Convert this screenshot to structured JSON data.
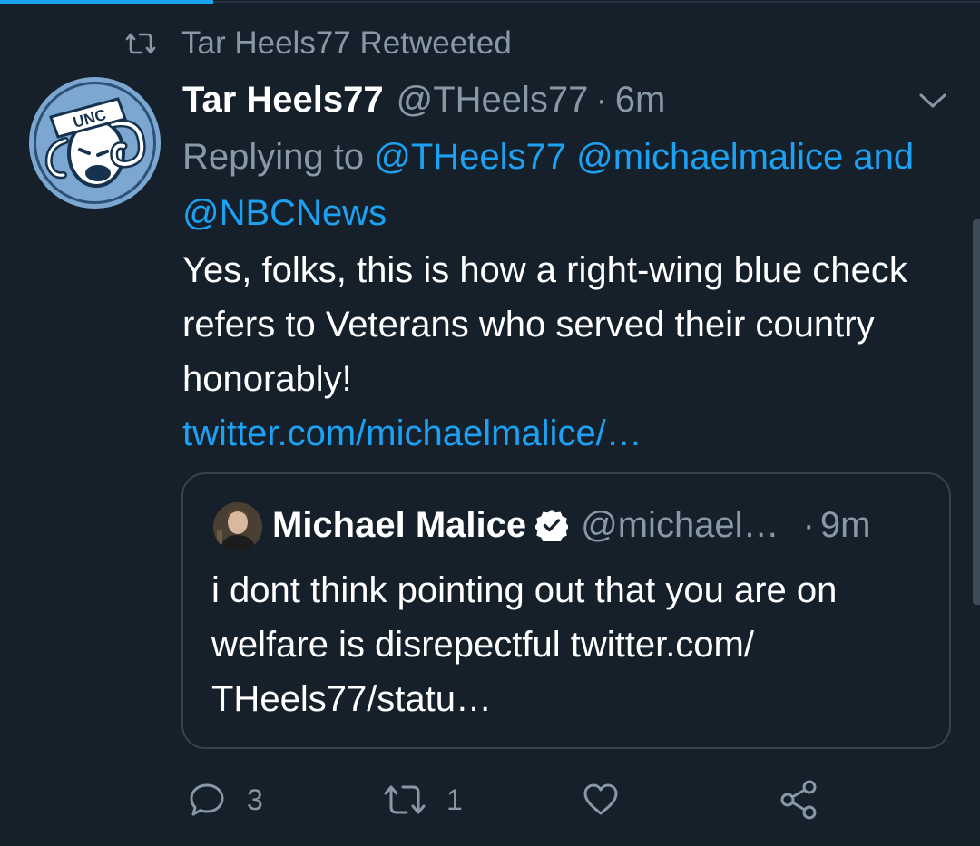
{
  "retweet_context": {
    "text": "Tar Heels77 Retweeted",
    "icon": "retweet-icon"
  },
  "tweet": {
    "author_name": "Tar Heels77",
    "author_handle": "@THeels77",
    "separator": "·",
    "time": "6m",
    "replying_prefix": "Replying to",
    "replying_mention_1": "@THeels77",
    "replying_mention_2": "@michaelmalice",
    "replying_and": "and",
    "replying_mention_3": "@NBCNews",
    "text": "Yes, folks, this is how a right-wing blue check refers to Veterans who served their country honorably!",
    "link": "twitter.com/michaelmalice/…",
    "avatar_label": "UNC"
  },
  "quoted_tweet": {
    "author_name": "Michael Malice",
    "author_handle": "@michael…",
    "separator": "·",
    "time": "9m",
    "text": "i dont think pointing out that you are on welfare is disrepectful twitter.com/ THeels77/statu…",
    "verified": true
  },
  "actions": {
    "reply_count": "3",
    "retweet_count": "1",
    "like_count": "",
    "share_count": ""
  },
  "colors": {
    "background": "#15202b",
    "text_primary": "#ffffff",
    "text_secondary": "#8899a6",
    "accent": "#1da1f2",
    "border": "#38444d"
  }
}
